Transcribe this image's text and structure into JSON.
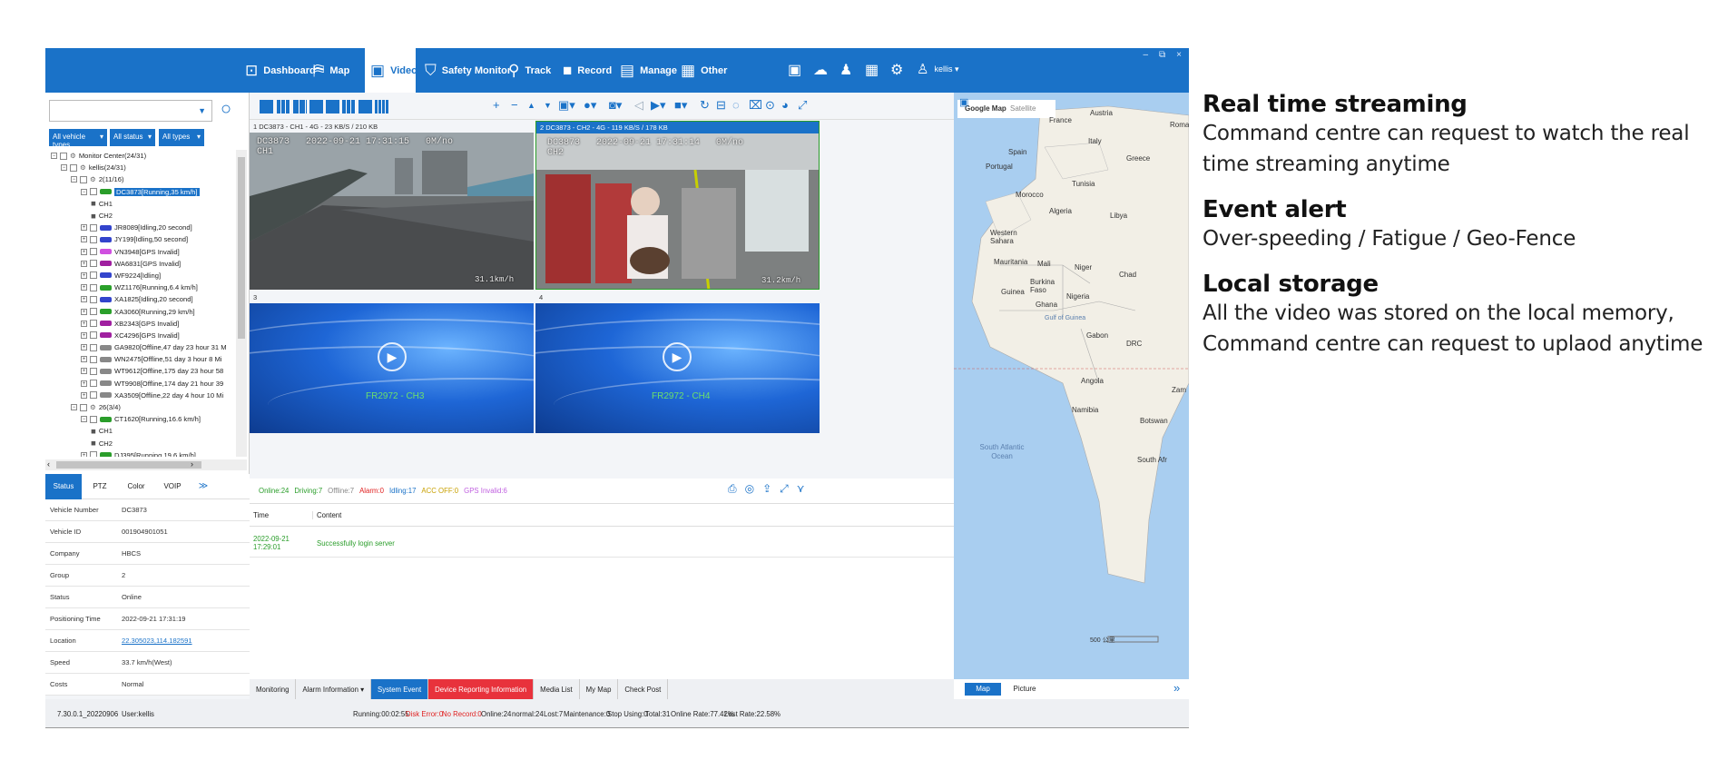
{
  "nav": {
    "items": [
      {
        "label": "Dashboard",
        "icon": "dashboard-icon"
      },
      {
        "label": "Map",
        "icon": "map-icon"
      },
      {
        "label": "Video",
        "icon": "video-icon",
        "active": true
      },
      {
        "label": "Safety Monitor",
        "icon": "shield-icon"
      },
      {
        "label": "Track",
        "icon": "track-icon"
      },
      {
        "label": "Record",
        "icon": "record-icon"
      },
      {
        "label": "Manage",
        "icon": "manage-icon"
      },
      {
        "label": "Other",
        "icon": "grid-icon"
      }
    ],
    "user": "kellis ▾",
    "window_controls": [
      "–",
      "⧉",
      "×"
    ]
  },
  "left": {
    "filters": [
      "All vehicle types",
      "All status",
      "All types"
    ],
    "tree": [
      {
        "label": "Monitor Center(24/31)"
      },
      {
        "label": "kellis(24/31)"
      },
      {
        "label": "2(11/16)"
      },
      {
        "label": "DC3873[Running,35 km/h]",
        "selected": true
      },
      {
        "label": "CH1"
      },
      {
        "label": "CH2"
      },
      {
        "label": "JR8089[Idling,20 second]"
      },
      {
        "label": "JY199[Idling,50 second]"
      },
      {
        "label": "VN3948[GPS Invalid]"
      },
      {
        "label": "WA6831[GPS Invalid]"
      },
      {
        "label": "WF9224[Idling]"
      },
      {
        "label": "WZ1176[Running,6.4 km/h]"
      },
      {
        "label": "XA1825[Idling,20 second]"
      },
      {
        "label": "XA3060[Running,29 km/h]"
      },
      {
        "label": "XB2343[GPS Invalid]"
      },
      {
        "label": "XC4296[GPS Invalid]"
      },
      {
        "label": "GA9820[Offline,47 day 23 hour 31 M"
      },
      {
        "label": "WN2475[Offline,51 day 3 hour 8 Mi"
      },
      {
        "label": "WT9612[Offline,175 day 23 hour 58"
      },
      {
        "label": "WT9908[Offline,174 day 21 hour 39"
      },
      {
        "label": "XA3509[Offline,22 day 4 hour 10 Mi"
      },
      {
        "label": "26(3/4)"
      },
      {
        "label": "CT1620[Running,16.6 km/h]"
      },
      {
        "label": "CH1"
      },
      {
        "label": "CH2"
      },
      {
        "label": "DJ395[Running,19.6 km/h]"
      }
    ],
    "tabs": [
      "Status",
      "PTZ",
      "Color",
      "VOIP"
    ],
    "info": [
      {
        "k": "Vehicle Number",
        "v": "DC3873"
      },
      {
        "k": "Vehicle ID",
        "v": "001904901051"
      },
      {
        "k": "Company",
        "v": "HBCS"
      },
      {
        "k": "Group",
        "v": "2"
      },
      {
        "k": "Status",
        "v": "Online"
      },
      {
        "k": "Positioning Time",
        "v": "2022-09-21 17:31:19"
      },
      {
        "k": "Location",
        "v": "22.305023,114.182591"
      },
      {
        "k": "Speed",
        "v": "33.7 km/h(West)"
      },
      {
        "k": "Costs",
        "v": "Normal"
      }
    ]
  },
  "video": {
    "cells": [
      {
        "header": "1 DC3873 - CH1 - 4G - 23 KB/S / 210 KB",
        "osd_top": "DC3873   2022-09-21 17:31:15   0M/no\nCH1",
        "osd_speed": "31.1km/h"
      },
      {
        "header": "2 DC3873 - CH2 - 4G - 119 KB/S / 178 KB",
        "osd_top": "DC3873   2022-09-21 17:31:14   0M/no\nCH2",
        "osd_speed": "31.2km/h"
      },
      {
        "header": "3",
        "label": "FR2972 - CH3"
      },
      {
        "header": "4",
        "label": "FR2972 - CH4"
      }
    ]
  },
  "events": {
    "counts": [
      {
        "text": "Online:24",
        "color": "#2a9d2a"
      },
      {
        "text": "Driving:7",
        "color": "#2a9d2a"
      },
      {
        "text": "Offline:7",
        "color": "#888888"
      },
      {
        "text": "Alarm:0",
        "color": "#e02020"
      },
      {
        "text": "Idling:17",
        "color": "#1a72c8"
      },
      {
        "text": "ACC OFF:0",
        "color": "#c8a000"
      },
      {
        "text": "GPS Invalid:6",
        "color": "#c060e0"
      }
    ],
    "columns": [
      "Time",
      "Content"
    ],
    "rows": [
      {
        "time": "2022-09-21 17:29:01",
        "content": "Successfully login server"
      }
    ],
    "tabs": [
      "Monitoring",
      "Alarm Information ▾",
      "System Event",
      "Device Reporting Information",
      "Media List",
      "My Map",
      "Check Post"
    ]
  },
  "map": {
    "tabs": [
      "Google Map",
      "Satellite"
    ],
    "view_tabs": [
      "Map",
      "Picture"
    ],
    "labels": [
      "France",
      "Austria",
      "Roman",
      "Italy",
      "Spain",
      "Portugal",
      "Greece",
      "Tunisia",
      "Morocco",
      "Algeria",
      "Libya",
      "Western Sahara",
      "Mauritania",
      "Mali",
      "Niger",
      "Chad",
      "Burkina Faso",
      "Guinea",
      "Nigeria",
      "Ghana",
      "Gulf of Guinea",
      "Gabon",
      "DRC",
      "Angola",
      "Zam",
      "Namibia",
      "Botswan",
      "South Atlantic Ocean",
      "South Afr"
    ],
    "scale": "500 公里"
  },
  "status": {
    "version": "7.30.0.1_20220906",
    "user": "User:kellis",
    "running": "Running:00:02:55",
    "disk": "Disk Error:0",
    "record": "No Record:0",
    "online": "Online:24",
    "normal": "normal:24",
    "lost": "Lost:7",
    "maint": "Maintenance:0",
    "stop": "Stop Using:0",
    "total": "Total:31",
    "online_rate": "Online Rate:77.42%",
    "lost_rate": "Lost Rate:22.58%"
  },
  "side": [
    {
      "title": "Real time streaming",
      "body": "Command centre can request to watch the real time streaming anytime"
    },
    {
      "title": "Event alert",
      "body": "Over-speeding / Fatigue / Geo-Fence"
    },
    {
      "title": "Local storage",
      "body": "All the video was stored on the local memory, Command centre can request to uplaod anytime"
    }
  ]
}
